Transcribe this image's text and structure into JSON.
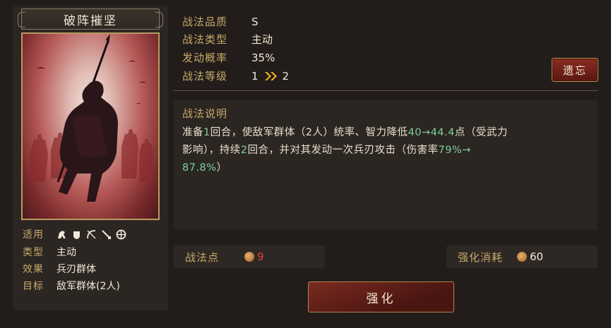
{
  "card": {
    "name": "破阵摧坚",
    "applicable_label": "适用",
    "applicable_icons": [
      "cavalry-icon",
      "shield-icon",
      "bow-icon",
      "spear-icon",
      "siege-icon"
    ],
    "type_label": "类型",
    "type_value": "主动",
    "effect_label": "效果",
    "effect_value": "兵刃群体",
    "target_label": "目标",
    "target_value": "敌军群体(2人)"
  },
  "info": {
    "quality_label": "战法品质",
    "quality_value": "S",
    "type_label": "战法类型",
    "type_value": "主动",
    "rate_label": "发动概率",
    "rate_value": "35%",
    "level_label": "战法等级",
    "level_current": "1",
    "level_next": "2",
    "forget_button": "遗忘"
  },
  "description": {
    "title": "战法说明",
    "line1_a": "准备",
    "line1_b": "1",
    "line1_c": "回合，使敌军群体（2人）统率、智力降低",
    "line1_d": "40→44.4",
    "line1_e": "点（受武力",
    "line2_a": "影响），持续",
    "line2_b": "2",
    "line2_c": "回合，并对其发动一次兵刃攻击（伤害率",
    "line2_d": "79%→",
    "line3_a": "87.8%",
    "line3_b": "）"
  },
  "points": {
    "label": "战法点",
    "value": "9"
  },
  "cost": {
    "label": "强化消耗",
    "value": "60"
  },
  "upgrade_button": "强化",
  "colors": {
    "accent_gold": "#c7a96a",
    "value_green": "#7fd09a",
    "value_red": "#e0403a",
    "button_red": "#7a2a20"
  }
}
